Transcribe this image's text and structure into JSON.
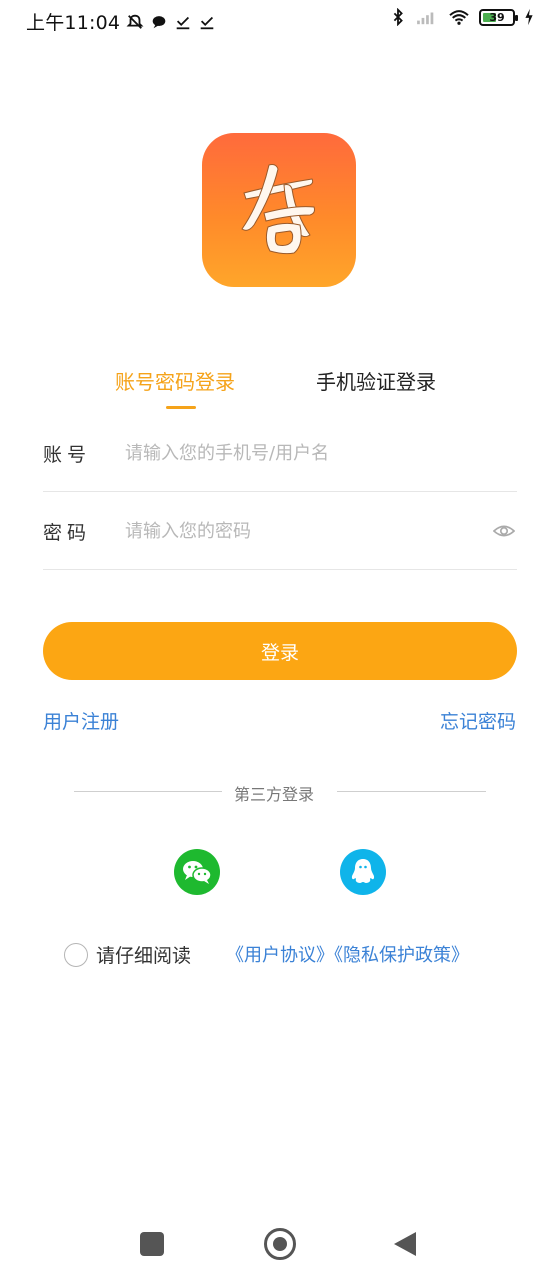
{
  "status_bar": {
    "time": "上午11:04",
    "battery": "39"
  },
  "tabs": {
    "active_label": "账号密码登录",
    "inactive_label": "手机验证登录"
  },
  "account_field": {
    "label": "账号",
    "placeholder": "请输入您的手机号/用户名",
    "value": ""
  },
  "password_field": {
    "label": "密码",
    "placeholder": "请输入您的密码",
    "value": ""
  },
  "login_button": {
    "label": "登录"
  },
  "links": {
    "register": "用户注册",
    "forgot": "忘记密码"
  },
  "third_party": {
    "label": "第三方登录"
  },
  "agreement": {
    "text": "请仔细阅读",
    "links": "《用户协议》《隐私保护政策》"
  },
  "colors": {
    "accent": "#fca613",
    "link": "#3b82d6",
    "wechat": "#1eb92f",
    "qq": "#0fb4ea"
  },
  "icons": {
    "logo": "app-logo-calligraphy",
    "eye": "eye-icon",
    "wechat": "wechat-icon",
    "qq": "qq-icon"
  }
}
